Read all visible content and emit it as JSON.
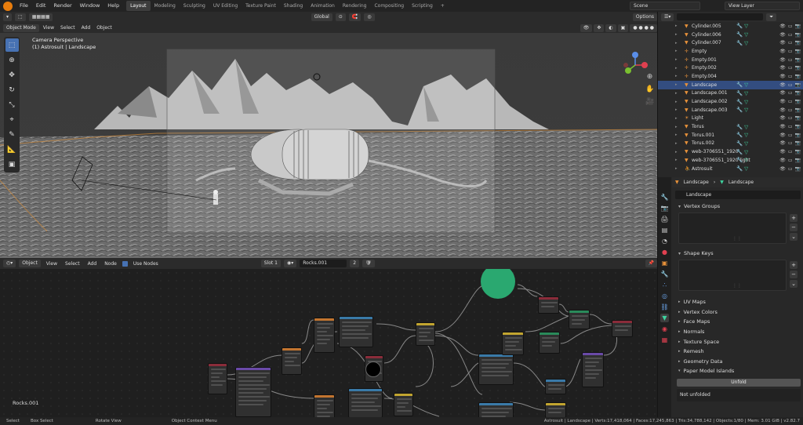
{
  "menus": [
    "File",
    "Edit",
    "Render",
    "Window",
    "Help"
  ],
  "workspaces": [
    "Layout",
    "Modeling",
    "Sculpting",
    "UV Editing",
    "Texture Paint",
    "Shading",
    "Animation",
    "Rendering",
    "Compositing",
    "Scripting"
  ],
  "active_workspace": "Layout",
  "scene_name": "Scene",
  "view_layer": "View Layer",
  "viewport": {
    "mode": "Object Mode",
    "menus": [
      "View",
      "Select",
      "Add",
      "Object"
    ],
    "transform_orientation": "Global",
    "options_label": "Options",
    "overlay_line1": "Camera Perspective",
    "overlay_line2": "(1) Astrosuit | Landscape"
  },
  "outliner": {
    "rows": [
      {
        "name": "Cylinder.005",
        "kind": "mesh",
        "selected": false
      },
      {
        "name": "Cylinder.006",
        "kind": "mesh",
        "selected": false
      },
      {
        "name": "Cylinder.007",
        "kind": "mesh",
        "selected": false
      },
      {
        "name": "Empty",
        "kind": "empty",
        "selected": false
      },
      {
        "name": "Empty.001",
        "kind": "empty",
        "selected": false
      },
      {
        "name": "Empty.002",
        "kind": "empty",
        "selected": false
      },
      {
        "name": "Empty.004",
        "kind": "empty",
        "selected": false
      },
      {
        "name": "Landscape",
        "kind": "mesh",
        "selected": true
      },
      {
        "name": "Landscape.001",
        "kind": "mesh",
        "selected": false
      },
      {
        "name": "Landscape.002",
        "kind": "mesh",
        "selected": false
      },
      {
        "name": "Landscape.003",
        "kind": "mesh",
        "selected": false
      },
      {
        "name": "Light",
        "kind": "light",
        "selected": false
      },
      {
        "name": "Torus",
        "kind": "mesh",
        "selected": false
      },
      {
        "name": "Torus.001",
        "kind": "mesh",
        "selected": false
      },
      {
        "name": "Torus.002",
        "kind": "mesh",
        "selected": false
      },
      {
        "name": "web-3706551_1920",
        "kind": "mesh",
        "selected": false
      },
      {
        "name": "web-3706551_1920 light",
        "kind": "mesh",
        "selected": false
      },
      {
        "name": "Astrosuit",
        "kind": "armature",
        "selected": false
      }
    ]
  },
  "properties": {
    "breadcrumb_object": "Landscape",
    "breadcrumb_data": "Landscape",
    "mesh_name": "Landscape",
    "vertex_groups": "Vertex Groups",
    "shape_keys": "Shape Keys",
    "collapsed_panels": [
      "UV Maps",
      "Vertex Colors",
      "Face Maps",
      "Normals",
      "Texture Space",
      "Remesh",
      "Geometry Data",
      "Paper Model Islands"
    ],
    "unfold_label": "Unfold",
    "not_unfolded_label": "Not unfolded"
  },
  "node_editor": {
    "type": "Object",
    "menus": [
      "View",
      "Select",
      "Add",
      "Node"
    ],
    "use_nodes_label": "Use Nodes",
    "slot": "Slot 1",
    "material": "Rocks.001",
    "users": "2",
    "label": "Rocks.001"
  },
  "statusbar": {
    "left": [
      "Select",
      "Box Select",
      "Rotate View",
      "Object Context Menu"
    ],
    "stats": "Astrosuit | Landscape | Verts:17,418,064 | Faces:17,245,863 | Tris:34,788,142 | Objects:1/80 | Mem: 3.01 GiB | v2.82.7"
  },
  "colors": {
    "selection": "#334d80",
    "active_tool": "#4772b3",
    "object_orange": "#e8923a",
    "modifier_blue": "#6aa3e8",
    "mesh_data_green": "#3fd4a0"
  }
}
